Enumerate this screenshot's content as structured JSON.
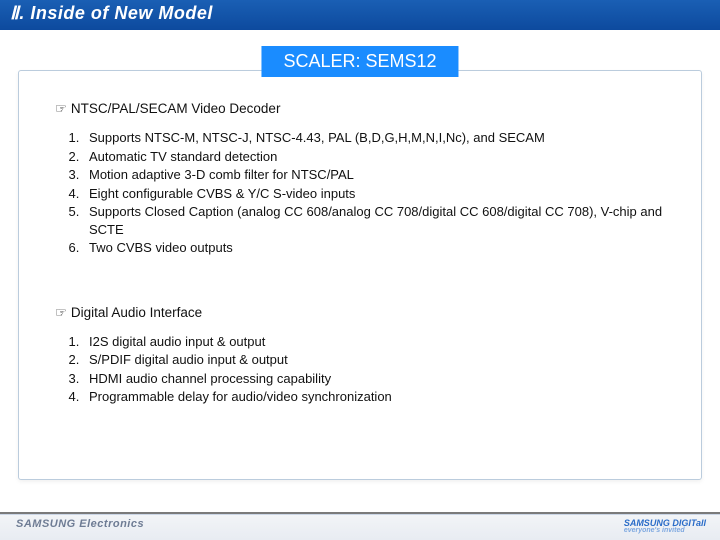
{
  "header": {
    "title": "Ⅱ. Inside of New Model"
  },
  "badge": {
    "text": "SCALER: SEMS12"
  },
  "sectionA": {
    "heading": "☞ NTSC/PAL/SECAM Video Decoder",
    "items": [
      "Supports NTSC-M, NTSC-J, NTSC-4.43, PAL (B,D,G,H,M,N,I,Nc), and SECAM",
      "Automatic TV standard detection",
      "Motion adaptive 3-D comb filter for NTSC/PAL",
      "Eight configurable CVBS & Y/C S-video inputs",
      "Supports Closed Caption (analog CC 608/analog CC 708/digital CC 608/digital CC 708), V-chip and SCTE",
      "Two CVBS video outputs"
    ]
  },
  "sectionB": {
    "heading": "☞ Digital Audio Interface",
    "items": [
      "I2S digital audio input & output",
      "S/PDIF digital audio input & output",
      "HDMI audio channel processing capability",
      "Programmable delay for audio/video synchronization"
    ]
  },
  "footer": {
    "left": "SAMSUNG Electronics",
    "right_main": "SAMSUNG DIGITall",
    "right_tag": "everyone's invited"
  }
}
